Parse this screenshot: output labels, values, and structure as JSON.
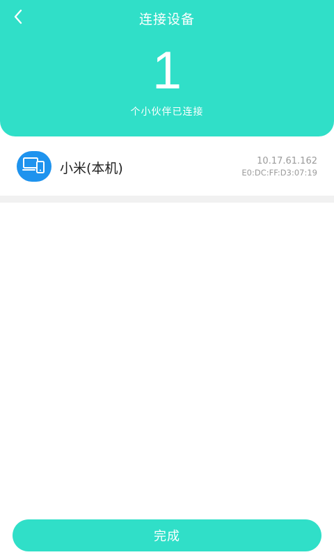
{
  "header": {
    "title": "连接设备",
    "connected_count": "1",
    "subtitle": "个小伙伴已连接",
    "back_icon": "chevron-left-icon"
  },
  "devices": [
    {
      "name": "小米(本机)",
      "ip": "10.17.61.162",
      "mac": "E0:DC:FF:D3:07:19",
      "icon": "devices-icon"
    }
  ],
  "footer": {
    "done_label": "完成"
  },
  "colors": {
    "accent": "#30dfc8",
    "avatar": "#1e93ee",
    "secondary_text": "#9a9a9a"
  }
}
